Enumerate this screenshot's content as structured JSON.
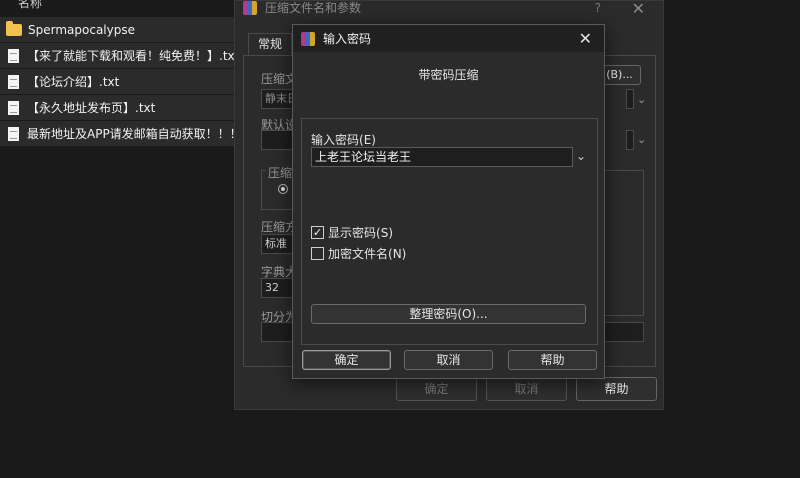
{
  "file_list": {
    "header": "名称",
    "items": [
      {
        "type": "folder",
        "name": "Spermapocalypse"
      },
      {
        "type": "file",
        "name": "【来了就能下载和观看！纯免费！】.txt"
      },
      {
        "type": "file",
        "name": "【论坛介绍】.txt"
      },
      {
        "type": "file",
        "name": "【永久地址发布页】.txt"
      },
      {
        "type": "file",
        "name": "最新地址及APP请发邮箱自动获取！！！ ..."
      }
    ]
  },
  "bg_dialog": {
    "title": "压缩文件名和参数",
    "help_glyph": "?",
    "close_glyph": "✕",
    "tab_general": "常规",
    "label_archive": "压缩文",
    "field_archive": "静末日",
    "browse_tail": "(B)...",
    "label_default": "默认设",
    "label_format": "压缩",
    "label_method": "压缩方",
    "field_method": "标准",
    "label_dict": "字典大",
    "field_dict": "32",
    "label_split": "切分为",
    "ok": "确定",
    "cancel": "取消",
    "help": "帮助"
  },
  "pw_dialog": {
    "title": "输入密码",
    "close_glyph": "✕",
    "subtitle": "带密码压缩",
    "password_label": "输入密码",
    "password_label_key": "(E)",
    "password_value": "上老王论坛当老王",
    "show_password_label": "显示密码",
    "show_password_key": "(S)",
    "show_password_checked": true,
    "encrypt_names_label": "加密文件名",
    "encrypt_names_key": "(N)",
    "encrypt_names_checked": false,
    "manage_button": "整理密码(O)...",
    "ok": "确定",
    "cancel": "取消",
    "help": "帮助"
  }
}
